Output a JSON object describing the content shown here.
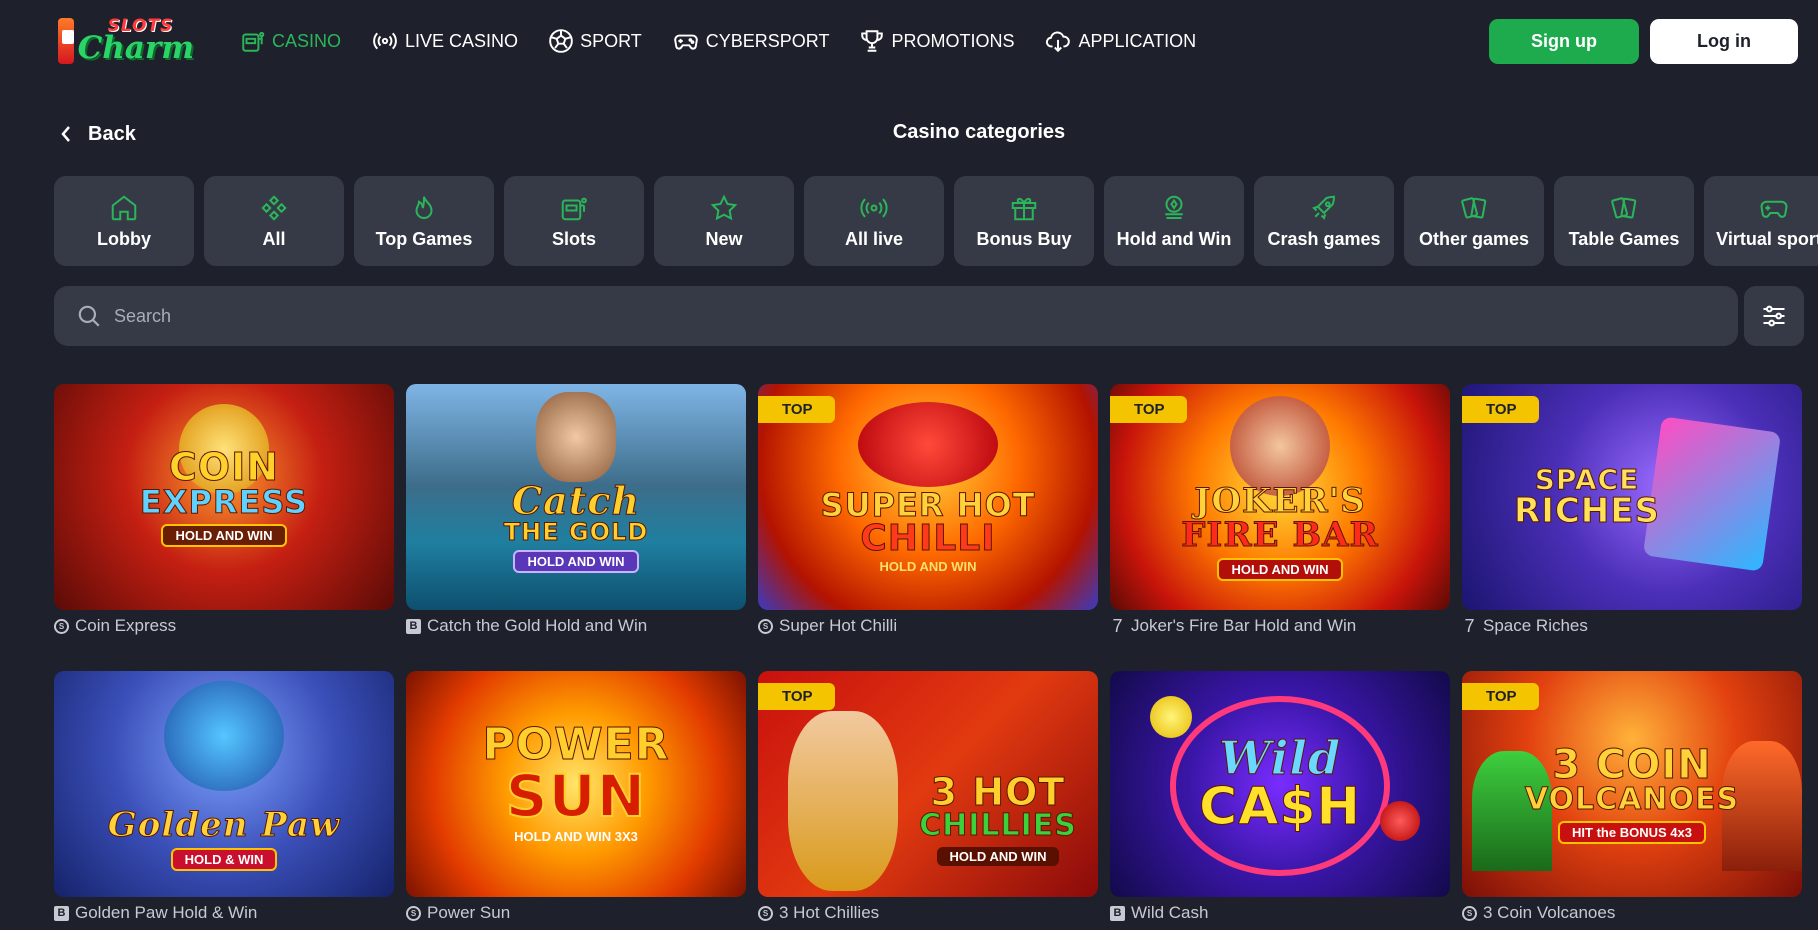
{
  "header": {
    "logo": {
      "line1": "SLOTS",
      "line2": "Charm"
    },
    "nav": [
      {
        "label": "CASINO",
        "icon": "slot-machine-icon",
        "active": true
      },
      {
        "label": "LIVE CASINO",
        "icon": "broadcast-icon",
        "active": false
      },
      {
        "label": "SPORT",
        "icon": "soccer-ball-icon",
        "active": false
      },
      {
        "label": "CYBERSPORT",
        "icon": "gamepad-icon",
        "active": false
      },
      {
        "label": "PROMOTIONS",
        "icon": "trophy-icon",
        "active": false
      },
      {
        "label": "APPLICATION",
        "icon": "cloud-download-icon",
        "active": false
      }
    ],
    "signup_label": "Sign up",
    "login_label": "Log in"
  },
  "subheader": {
    "back_label": "Back",
    "title": "Casino categories"
  },
  "categories": [
    {
      "label": "Lobby",
      "icon": "home-icon"
    },
    {
      "label": "All",
      "icon": "diamond-grid-icon"
    },
    {
      "label": "Top Games",
      "icon": "flame-icon"
    },
    {
      "label": "Slots",
      "icon": "slot-machine-icon"
    },
    {
      "label": "New",
      "icon": "star-icon"
    },
    {
      "label": "All live",
      "icon": "broadcast-icon"
    },
    {
      "label": "Bonus Buy",
      "icon": "gift-icon"
    },
    {
      "label": "Hold and Win",
      "icon": "coin-stack-icon"
    },
    {
      "label": "Crash games",
      "icon": "rocket-icon"
    },
    {
      "label": "Other games",
      "icon": "cards-icon"
    },
    {
      "label": "Table Games",
      "icon": "cards-icon"
    },
    {
      "label": "Virtual sports",
      "icon": "gamepad-icon"
    }
  ],
  "search": {
    "placeholder": "Search",
    "value": ""
  },
  "colors": {
    "accent": "#1eab4e",
    "background": "#1e212b",
    "card": "#363a47",
    "badge": "#f5c400"
  },
  "top_badge_label": "TOP",
  "games": [
    {
      "name": "Coin Express",
      "provider": "ring",
      "top": false,
      "art": [
        "COIN",
        "EXPRESS"
      ],
      "sub": "HOLD AND WIN"
    },
    {
      "name": "Catch the Gold Hold and Win",
      "provider": "box-b",
      "top": false,
      "art": [
        "Catch",
        "THE GOLD"
      ],
      "sub": "HOLD AND WIN"
    },
    {
      "name": "Super Hot Chilli",
      "provider": "ring",
      "top": true,
      "art": [
        "SUPER HOT",
        "CHILLI"
      ],
      "sub": "HOLD AND WIN"
    },
    {
      "name": "Joker's Fire Bar Hold and Win",
      "provider": "seven",
      "top": true,
      "art": [
        "JOKER'S",
        "FIRE BAR"
      ],
      "sub": "HOLD AND WIN"
    },
    {
      "name": "Space Riches",
      "provider": "seven",
      "top": true,
      "art": [
        "SPACE",
        "RICHES"
      ],
      "sub": ""
    },
    {
      "name": "Golden Paw Hold & Win",
      "provider": "box-b",
      "top": false,
      "art": [
        "Golden Paw",
        ""
      ],
      "sub": "HOLD & WIN"
    },
    {
      "name": "Power Sun",
      "provider": "ring",
      "top": false,
      "art": [
        "POWER",
        "SUN"
      ],
      "sub": "HOLD AND WIN 3X3"
    },
    {
      "name": "3 Hot Chillies",
      "provider": "ring",
      "top": true,
      "art": [
        "3 HOT",
        "CHILLIES"
      ],
      "sub": "HOLD AND WIN"
    },
    {
      "name": "Wild Cash",
      "provider": "box-b",
      "top": false,
      "art": [
        "Wild",
        "CA$H"
      ],
      "sub": ""
    },
    {
      "name": "3 Coin Volcanoes",
      "provider": "ring",
      "top": true,
      "art": [
        "3 COIN",
        "VOLCANOES"
      ],
      "sub": "HIT the BONUS 4x3"
    }
  ]
}
